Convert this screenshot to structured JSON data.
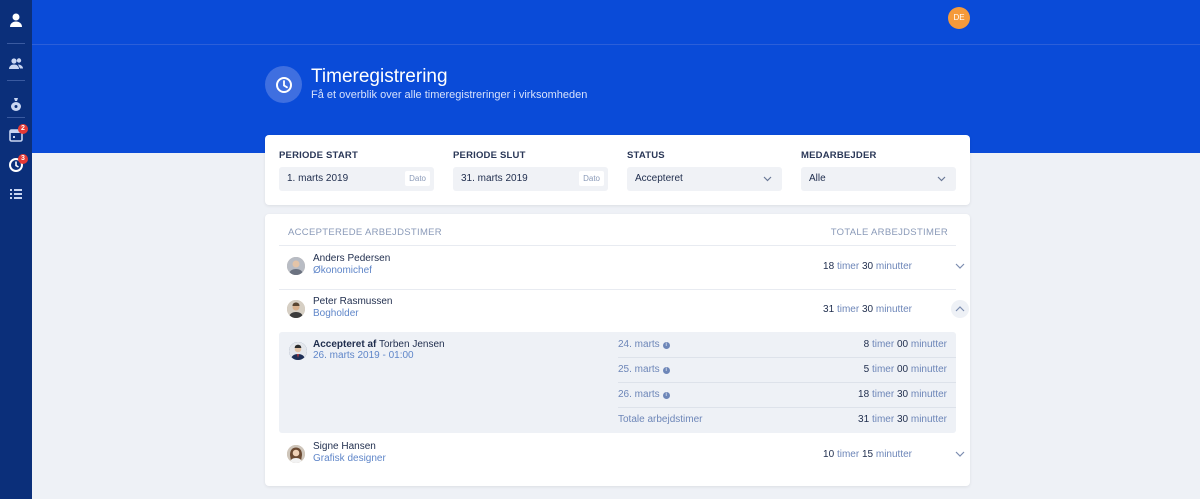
{
  "user_initials": "DE",
  "sidebar": {
    "items": [
      {
        "icon": "profile-icon"
      },
      {
        "icon": "users-icon"
      },
      {
        "icon": "money-bag-icon"
      },
      {
        "icon": "calendar-icon",
        "badge": "2"
      },
      {
        "icon": "clock-icon",
        "badge": "3"
      },
      {
        "icon": "list-icon"
      }
    ]
  },
  "header": {
    "title": "Timeregistrering",
    "subtitle": "Få et overblik over alle timeregistreringer i virksomheden",
    "icon": "clock-icon"
  },
  "filters": {
    "start": {
      "label": "PERIODE START",
      "value": "1. marts 2019",
      "tag": "Dato"
    },
    "end": {
      "label": "PERIODE SLUT",
      "value": "31. marts 2019",
      "tag": "Dato"
    },
    "status": {
      "label": "STATUS",
      "value": "Accepteret"
    },
    "employee": {
      "label": "MEDARBEJDER",
      "value": "Alle"
    }
  },
  "list": {
    "col_left": "ACCEPTEREDE ARBEJDSTIMER",
    "col_right": "TOTALE ARBEJDSTIMER",
    "hours_unit": "timer",
    "minutes_unit": "minutter",
    "employees": [
      {
        "name": "Anders Pedersen",
        "role": "Økonomichef",
        "hours": "18",
        "minutes": "30",
        "expanded": false
      },
      {
        "name": "Peter Rasmussen",
        "role": "Bogholder",
        "hours": "31",
        "minutes": "30",
        "expanded": true
      },
      {
        "name": "Signe Hansen",
        "role": "Grafisk designer",
        "hours": "10",
        "minutes": "15",
        "expanded": false
      }
    ],
    "detail": {
      "accepted_label": "Accepteret af",
      "accepted_by": "Torben Jensen",
      "accepted_date": "26. marts 2019 - 01:00",
      "days": [
        {
          "day": "24. marts",
          "hours": "8",
          "minutes": "00"
        },
        {
          "day": "25. marts",
          "hours": "5",
          "minutes": "00"
        },
        {
          "day": "26. marts",
          "hours": "18",
          "minutes": "30"
        }
      ],
      "total_label": "Totale arbejdstimer",
      "total_hours": "31",
      "total_minutes": "30"
    }
  }
}
